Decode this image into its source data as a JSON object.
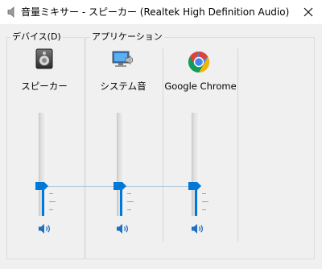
{
  "window": {
    "title": "音量ミキサー - スピーカー (Realtek High Definition Audio)",
    "close_glyph": "✕"
  },
  "groups": {
    "device_label": "デバイス(D)",
    "apps_label": "アプリケーション"
  },
  "channels": [
    {
      "label": "スピーカー",
      "icon": "speaker-device-icon",
      "volume": 0.25,
      "muted": false
    },
    {
      "label": "システム音",
      "icon": "system-sounds-icon",
      "volume": 0.25,
      "muted": false
    },
    {
      "label": "Google Chrome",
      "icon": "chrome-icon",
      "volume": 0.25,
      "muted": false
    }
  ],
  "colors": {
    "accent": "#0078d7",
    "chrome_red": "#db4437",
    "chrome_green": "#0f9d58",
    "chrome_yellow": "#f4b400",
    "chrome_blue": "#4285f4"
  }
}
